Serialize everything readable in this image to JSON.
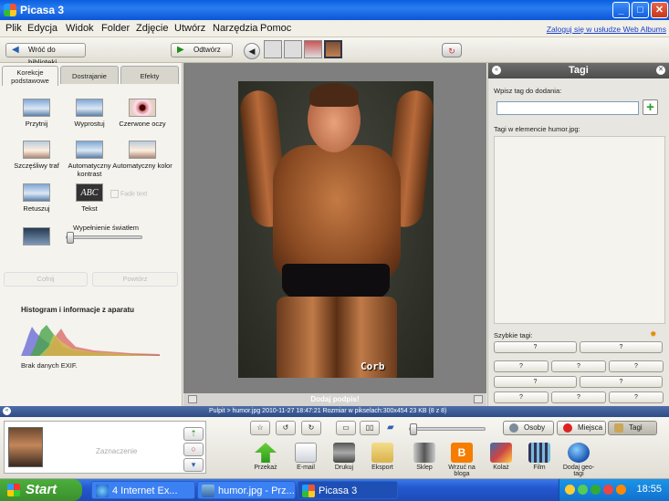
{
  "window": {
    "title": "Picasa 3",
    "controls": {
      "minimize": "_",
      "maximize": "□",
      "close": "✕"
    }
  },
  "menu": {
    "items": [
      "Plik",
      "Edycja",
      "Widok",
      "Folder",
      "Zdjęcie",
      "Utwórz",
      "Narzędzia",
      "Pomoc"
    ],
    "signin_link": "Zaloguj się w usłudze Web Albums"
  },
  "toolbar": {
    "back_label": "Wróć do biblioteki",
    "play_label": "Odtwórz"
  },
  "left_panel": {
    "tabs": [
      "Korekcje podstawowe",
      "Dostrajanie",
      "Efekty"
    ],
    "tools": {
      "crop": "Przytnij",
      "straighten": "Wyprostuj",
      "redeye": "Czerwone oczy",
      "lucky": "Szczęśliwy traf",
      "auto_contrast": "Automatyczny kontrast",
      "auto_color": "Automatyczny kolor",
      "retouch": "Retuszuj",
      "text": "Tekst"
    },
    "text_icon": "ABC",
    "fade_label": "Fade text",
    "fill_light_label": "Wypełnienie światłem",
    "fill_light_level": 0,
    "undo": "Cofnij",
    "redo": "Powtórz",
    "histogram_title": "Histogram i informacje z aparatu",
    "exif_text": "Brak danych EXIF."
  },
  "center": {
    "watermark": "Corb",
    "caption_placeholder": "Dodaj podpis!"
  },
  "right_panel": {
    "title": "Tagi",
    "input_label": "Wpisz tag do dodania:",
    "input_value": "",
    "tags_in_label": "Tagi w elemencie humor.jpg:",
    "quick_tags_label": "Szybkie tagi:",
    "quick_tag": "?"
  },
  "status": {
    "path": "Pulpit > humor.jpg 2010-11-27 18:47:21 Rozmiar w pikselach:300x454 23 KB    (8 z 8)"
  },
  "bottom": {
    "selection_label": "Zaznaczenie",
    "actions": [
      "Przekaż",
      "E-mail",
      "Drukuj",
      "Eksport",
      "Sklep",
      "Wrzuć na bloga",
      "Kolaż",
      "Film",
      "Dodaj geo-tagi"
    ],
    "panel_tabs": [
      "Osoby",
      "Miejsca",
      "Tagi"
    ]
  },
  "taskbar": {
    "start": "Start",
    "tasks": [
      "4 Internet Ex...",
      "humor.jpg - Prz...",
      "Picasa 3"
    ],
    "clock": "18:55"
  },
  "colors": {
    "title_blue": "#0a5fe0",
    "link_blue": "#1a3fcf",
    "add_green": "#2a9a2a",
    "status_blue": "#2d4c86"
  }
}
